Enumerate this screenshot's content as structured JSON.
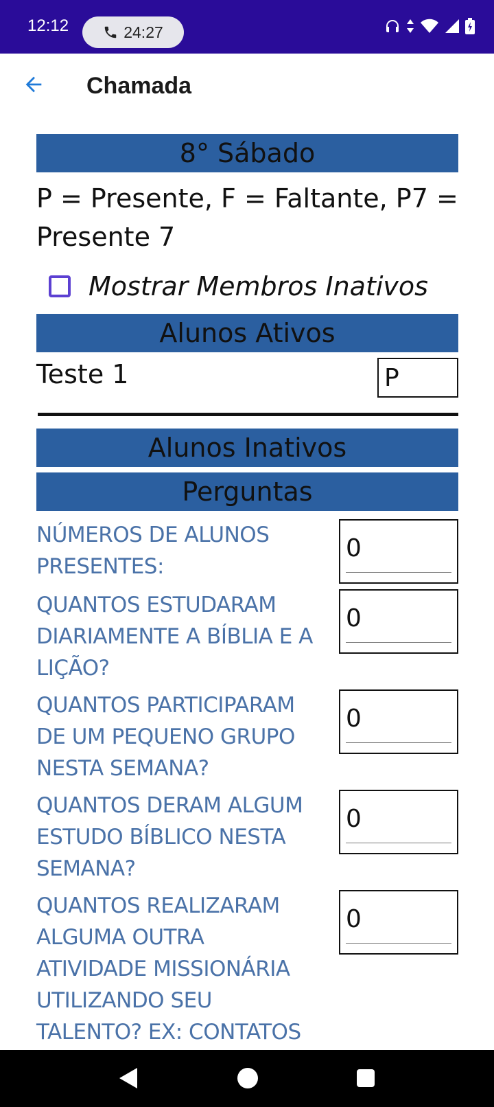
{
  "status_bar": {
    "time": "12:12",
    "call_timer": "24:27",
    "icons": [
      "phone-icon",
      "headphones-icon",
      "data-arrows-icon",
      "wifi-icon",
      "signal-icon",
      "battery-icon"
    ]
  },
  "app_bar": {
    "title": "Chamada"
  },
  "section": {
    "header": "8° Sábado",
    "legend": "P = Presente, F = Faltante, P7 = Presente 7",
    "checkbox_label": "Mostrar Membros Inativos",
    "checkbox_checked": false
  },
  "active_students": {
    "header": "Alunos Ativos",
    "items": [
      {
        "name": "Teste 1",
        "value": "P"
      }
    ]
  },
  "inactive_students": {
    "header": "Alunos Inativos"
  },
  "questions": {
    "header": "Perguntas",
    "items": [
      {
        "text": "NÚMEROS DE ALUNOS PRESENTES:",
        "value": "0"
      },
      {
        "text": "QUANTOS ESTUDARAM DIARIAMENTE A BÍBLIA E A LIÇÃO?",
        "value": "0"
      },
      {
        "text": "QUANTOS PARTICIPARAM DE UM PEQUENO GRUPO NESTA SEMANA?",
        "value": "0"
      },
      {
        "text": "QUANTOS DERAM ALGUM ESTUDO BÍBLICO NESTA SEMANA?",
        "value": "0"
      },
      {
        "text": "QUANTOS REALIZARAM ALGUMA OUTRA ATIVIDADE MISSIONÁRIA UTILIZANDO SEU TALENTO? EX: CONTATOS",
        "value": "0"
      }
    ]
  },
  "colors": {
    "status_bar": "#2a0c99",
    "band": "#2b5fa0",
    "question_text": "#4a72a8",
    "checkbox_border": "#5c40d2",
    "back_arrow": "#1f7ad8"
  }
}
